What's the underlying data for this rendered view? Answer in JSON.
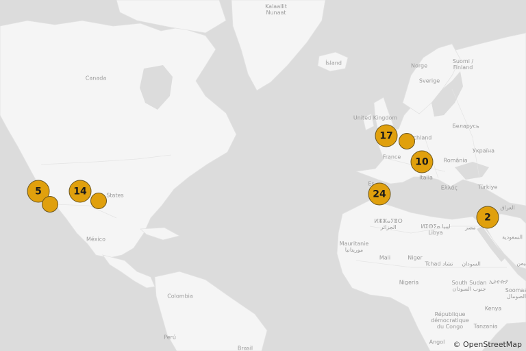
{
  "labels": {
    "greenland": "Kalaallit\nNunaat",
    "canada": "Canada",
    "iceland": "Ísland",
    "norge": "Norge",
    "sverige": "Sverige",
    "finland": "Suomi /\nFinland",
    "uk": "United Kingdom",
    "germany": "chland",
    "belarus": "Беларусь",
    "france": "France",
    "ukraine": "Україна",
    "romania": "România",
    "italia": "Italia",
    "espana": "Es",
    "ellas": "Ελλάς",
    "turkiye": "Türkiye",
    "iraq": "العراق",
    "states": "States",
    "mexico": "México",
    "algeria": "ⵍⵣⵣⴰⵢⴻⵔ\nالجزائر",
    "libya": "ⵍⵉⴱⵢⴰ ليبيا\nLibya",
    "egypt": "مصر",
    "saudi": "السعودية",
    "mauritanie": "Mauritanie\nموريتانيا",
    "mali": "Mali",
    "niger": "Niger",
    "tchad": "Tchad تشاد",
    "sudan": "السودان",
    "yemen": "ليمن",
    "nigeria": "Nigeria",
    "southsudan": "South Sudan\nجنوب السودان",
    "ethiopia": "ኢትዮጵያ",
    "somalia": "Soomaa\nالصومال",
    "colombia": "Colombia",
    "rdc": "République\ndémocratique\ndu Congo",
    "kenya": "Kenya",
    "tanzania": "Tanzania",
    "peru": "Perú",
    "brasil": "Brasil",
    "angola": "Angol"
  },
  "clusters": [
    {
      "id": "california",
      "count": "5"
    },
    {
      "id": "california-single",
      "count": ""
    },
    {
      "id": "mountain",
      "count": "14"
    },
    {
      "id": "mountain-single",
      "count": ""
    },
    {
      "id": "uk-benelux",
      "count": "17"
    },
    {
      "id": "germany-single",
      "count": ""
    },
    {
      "id": "alps",
      "count": "10"
    },
    {
      "id": "iberia",
      "count": "24"
    },
    {
      "id": "middle-east",
      "count": "2"
    }
  ],
  "colors": {
    "marker": "#e0a00d",
    "marker_border": "#6b5620",
    "land": "#f5f5f5",
    "water": "#dcdcdc"
  },
  "attribution": "© OpenStreetMap"
}
